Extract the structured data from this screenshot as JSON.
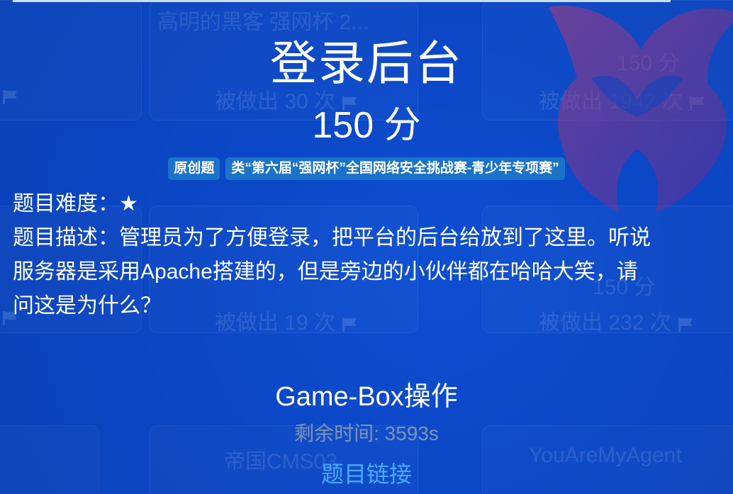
{
  "background": {
    "cards": [
      {
        "title": "高明的黑客 强网杯 2...",
        "subtitle": "",
        "solved": ""
      },
      {
        "title": "",
        "subtitle": "150 分",
        "solved": "被做出 30 次"
      },
      {
        "title": "",
        "subtitle": "150 分",
        "solved": "被做出 1942 次"
      },
      {
        "title": "",
        "subtitle": "",
        "solved": "被做出 19 次"
      },
      {
        "title": "",
        "subtitle": "150 分",
        "solved": "被做出 232 次"
      },
      {
        "title": "帝国CMS03",
        "subtitle": "",
        "solved": ""
      },
      {
        "title": "YouAreMyAgent",
        "subtitle": "",
        "solved": ""
      }
    ]
  },
  "challenge": {
    "title": "登录后台",
    "points": "150 分",
    "tags": [
      "原创题",
      "类“第六届“强网杯”全国网络安全挑战赛-青少年专项赛”"
    ],
    "difficulty": "题目难度：★",
    "description_lines": [
      "题目描述：管理员为了方便登录，把平台的后台给放到了这里。听说",
      "服务器是采用Apache搭建的，但是旁边的小伙伴都在哈哈大笑，请",
      "问这是为什么？"
    ]
  },
  "gamebox": {
    "title": "Game-Box操作",
    "timer": "剩余时间: 3593s",
    "link": "题目链接"
  },
  "colors": {
    "background": "#0b44c0",
    "tag": "#1a73c9",
    "link": "#4aa8ff",
    "timer": "#8193b3"
  }
}
